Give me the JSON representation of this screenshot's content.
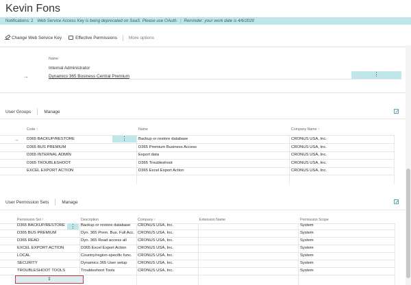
{
  "page_title": "Kevin Fons",
  "notification": {
    "count_label": "Notifications: 2",
    "message1": "Web Service Access Key is being deprecated on SaaS. Please use OAuth.",
    "message2": "Reminder: your work date is 4/6/2020"
  },
  "toolbar": {
    "change_key": "Change Web Service Key",
    "effective_permissions": "Effective Permissions",
    "more_options": "More options"
  },
  "plan_card": {
    "header": "Name",
    "role": "Internal Administrator",
    "plan": "Dynamics 365 Business Central Premium",
    "dots": "⋮"
  },
  "user_groups": {
    "title": "User Groups",
    "action": "Manage",
    "columns": {
      "code": "Code ↑",
      "name": "Name",
      "company": "Company Name ↑"
    },
    "rows": [
      {
        "code": "D365 BACKUP/RESTORE",
        "name": "Backup or restore database",
        "company": "CRONUS USA, Inc."
      },
      {
        "code": "D365 BUS PREMIUM",
        "name": "D365 Premium Business Access",
        "company": "CRONUS USA, Inc."
      },
      {
        "code": "D365 INTERNAL ADMIN",
        "name": "Export data",
        "company": "CRONUS USA, Inc."
      },
      {
        "code": "D365 TROUBLESHOOT",
        "name": "D365 Troubleshoot",
        "company": "CRONUS USA, Inc."
      },
      {
        "code": "EXCEL EXPORT ACTION",
        "name": "D365 Excel Export Action",
        "company": "CRONUS USA, Inc."
      }
    ],
    "dots": "⋮"
  },
  "permission_sets": {
    "title": "User Permission Sets",
    "action": "Manage",
    "columns": {
      "set": "Permission Set ↑",
      "description": "Description",
      "company": "Company ↑",
      "extension": "Extension Name",
      "scope": "Permission Scope"
    },
    "rows": [
      {
        "set": "D365 BACKUP/RESTORE",
        "description": "Backup or restore database",
        "company": "CRONUS USA, Inc.",
        "extension": "",
        "scope": "System"
      },
      {
        "set": "D365 BUS PREMIUM",
        "description": "Dyn. 365 Prem. Bus. Full Acc.",
        "company": "CRONUS USA, Inc.",
        "extension": "",
        "scope": "System"
      },
      {
        "set": "D365 READ",
        "description": "Dyn. 365 Read access all",
        "company": "CRONUS USA, Inc.",
        "extension": "",
        "scope": "System"
      },
      {
        "set": "EXCEL EXPORT ACTION",
        "description": "D365 Excel Export Action",
        "company": "CRONUS USA, Inc.",
        "extension": "",
        "scope": "System"
      },
      {
        "set": "LOCAL",
        "description": "Country/region-specific func.",
        "company": "CRONUS USA, Inc.",
        "extension": "",
        "scope": "System"
      },
      {
        "set": "SECURITY",
        "description": "Dynamics 365 User setup",
        "company": "CRONUS USA, Inc.",
        "extension": "",
        "scope": "System"
      },
      {
        "set": "TROUBLESHOOT TOOLS",
        "description": "Troubleshoot Tools",
        "company": "CRONUS USA, Inc.",
        "extension": "",
        "scope": "System"
      }
    ],
    "dots": "⋮",
    "new_row_mark": "↧"
  },
  "colors": {
    "accent": "#bfe7ea",
    "highlight": "#c2353a",
    "expand_icon": "#5aa4b0"
  }
}
